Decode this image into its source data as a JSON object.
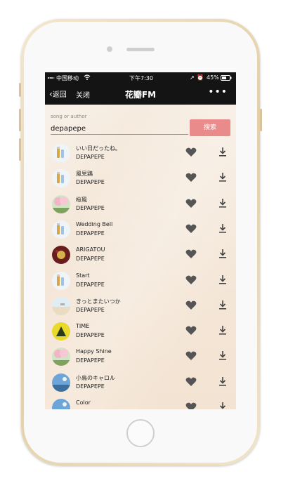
{
  "status": {
    "carrier": "中国移动",
    "time": "下午7:30",
    "battery": "45%"
  },
  "nav": {
    "back_label": "返回",
    "close_label": "关闭",
    "title": "花瓣FM",
    "more_label": "•••"
  },
  "search": {
    "label": "song or author",
    "value": "depapepe",
    "button_label": "搜索"
  },
  "songs": [
    {
      "title": "いい日だったね。",
      "artist": "DEPAPEPE",
      "art": "drinks"
    },
    {
      "title": "風見鶏",
      "artist": "DEPAPEPE",
      "art": "drinks"
    },
    {
      "title": "桜風",
      "artist": "DEPAPEPE",
      "art": "sakura"
    },
    {
      "title": "Wedding Bell",
      "artist": "DEPAPEPE",
      "art": "drinks"
    },
    {
      "title": "ARIGATOU",
      "artist": "DEPAPEPE",
      "art": "darkred"
    },
    {
      "title": "Start",
      "artist": "DEPAPEPE",
      "art": "drinks"
    },
    {
      "title": "きっとまたいつか",
      "artist": "DEPAPEPE",
      "art": "beach"
    },
    {
      "title": "TIME",
      "artist": "DEPAPEPE",
      "art": "yellow"
    },
    {
      "title": "Happy Shine",
      "artist": "DEPAPEPE",
      "art": "sakura"
    },
    {
      "title": "小鳥のキャロル",
      "artist": "DEPAPEPE",
      "art": "blue"
    },
    {
      "title": "Color",
      "artist": "",
      "art": "blue"
    }
  ],
  "colors": {
    "search_button": "#ea8b8b",
    "nav_bg": "#141414",
    "icon_gray": "#555555"
  }
}
